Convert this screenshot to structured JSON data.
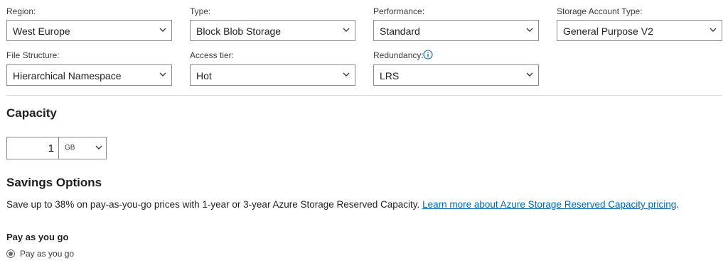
{
  "filters": {
    "region": {
      "label": "Region:",
      "value": "West Europe"
    },
    "type": {
      "label": "Type:",
      "value": "Block Blob Storage"
    },
    "performance": {
      "label": "Performance:",
      "value": "Standard"
    },
    "account_type": {
      "label": "Storage Account Type:",
      "value": "General Purpose V2"
    },
    "file_structure": {
      "label": "File Structure:",
      "value": "Hierarchical Namespace"
    },
    "access_tier": {
      "label": "Access tier:",
      "value": "Hot"
    },
    "redundancy": {
      "label": "Redundancy:",
      "value": "LRS"
    }
  },
  "capacity": {
    "heading": "Capacity",
    "amount": "1",
    "unit": "GB"
  },
  "savings": {
    "heading": "Savings Options",
    "text": "Save up to 38% on pay-as-you-go prices with 1-year or 3-year Azure Storage Reserved Capacity.",
    "link_text": "Learn more about Azure Storage Reserved Capacity pricing",
    "after_link": ".",
    "subheading": "Pay as you go",
    "option_label": "Pay as you go"
  },
  "colors": {
    "link": "#0066b8",
    "border": "#8a8a8a",
    "divider": "#d6d6d6"
  }
}
